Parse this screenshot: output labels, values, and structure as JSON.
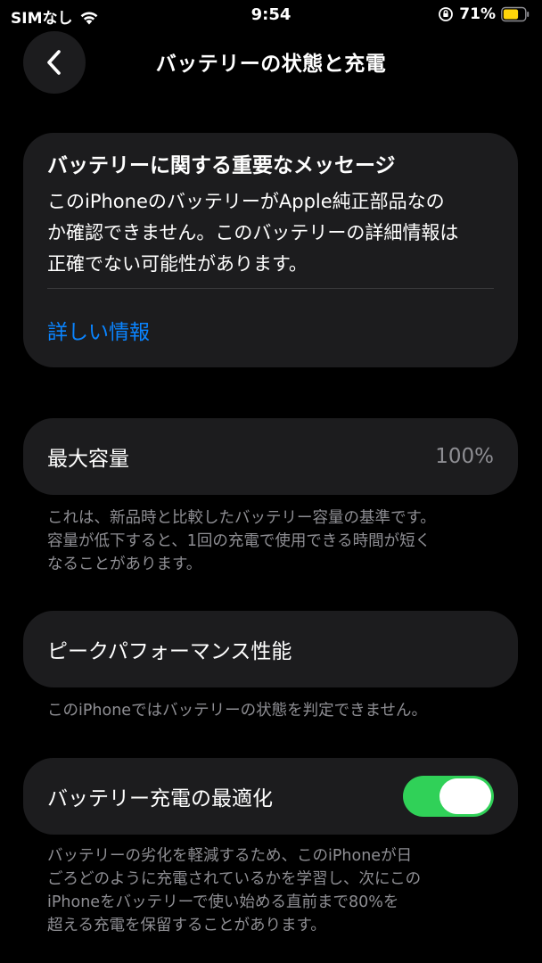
{
  "status_bar": {
    "carrier": "SIMなし",
    "time": "9:54",
    "battery_percent": "71%",
    "battery_level": 0.71,
    "battery_color": "#ffd60a"
  },
  "nav": {
    "title": "バッテリーの状態と充電",
    "back_icon": "chevron-left-icon"
  },
  "message_card": {
    "title": "バッテリーに関する重要なメッセージ",
    "body_lines": [
      "このiPhoneのバッテリーがApple純正部品なの",
      "か確認できません。このバッテリーの詳細情報は",
      "正確でない可能性があります。"
    ],
    "link_label": "詳しい情報"
  },
  "max_capacity": {
    "label": "最大容量",
    "value": "100%",
    "footnote_lines": [
      "これは、新品時と比較したバッテリー容量の基準です。",
      "容量が低下すると、1回の充電で使用できる時間が短く",
      "なることがあります。"
    ]
  },
  "peak_performance": {
    "label": "ピークパフォーマンス性能",
    "footnote_lines": [
      "このiPhoneではバッテリーの状態を判定できません。"
    ]
  },
  "optimized_charging": {
    "label": "バッテリー充電の最適化",
    "enabled": true,
    "footnote_lines": [
      "バッテリーの劣化を軽減するため、このiPhoneが日",
      "ごろどのように充電されているかを学習し、次にこの",
      "iPhoneをバッテリーで使い始める直前まで80%を",
      "超える充電を保留することがあります。"
    ]
  },
  "colors": {
    "background": "#000000",
    "card": "#1c1c1e",
    "link": "#0a84ff",
    "secondary_text": "#8e8e93",
    "toggle_on": "#30d158"
  }
}
